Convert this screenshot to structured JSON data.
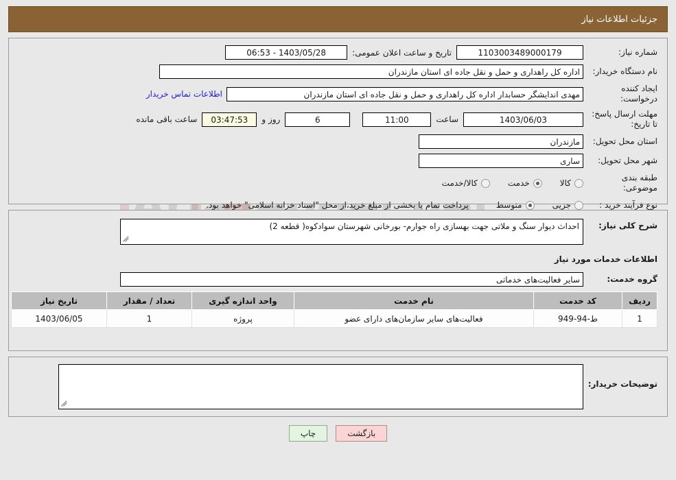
{
  "header": {
    "title": "جزئیات اطلاعات نیاز"
  },
  "form": {
    "need_number_label": "شماره نیاز:",
    "need_number_value": "1103003489000179",
    "public_announce_label": "تاریخ و ساعت اعلان عمومی:",
    "public_announce_value": "1403/05/28 - 06:53",
    "buyer_org_label": "نام دستگاه خریدار:",
    "buyer_org_value": "اداره کل راهداری و حمل و نقل جاده ای استان مازندران",
    "creator_label": "ایجاد کننده درخواست:",
    "creator_value": "مهدی اندایشگر حسابدار اداره کل راهداری و حمل و نقل جاده ای استان مازندران",
    "contact_link": "اطلاعات تماس خریدار",
    "deadline_label": "مهلت ارسال پاسخ: تا تاریخ:",
    "deadline_date": "1403/06/03",
    "hour_label": "ساعت",
    "deadline_time": "11:00",
    "remaining_days": "6",
    "days_and_label": "روز و",
    "remaining_clock": "03:47:53",
    "remaining_suffix": "ساعت باقی مانده",
    "province_label": "استان محل تحویل:",
    "province_value": "مازندران",
    "city_label": "شهر محل تحویل:",
    "city_value": "ساری",
    "category_label": "طبقه بندی موضوعی:",
    "category_options": [
      {
        "label": "کالا",
        "selected": false
      },
      {
        "label": "خدمت",
        "selected": true
      },
      {
        "label": "کالا/خدمت",
        "selected": false
      }
    ],
    "process_label": "نوع فرآیند خرید :",
    "process_options": [
      {
        "label": "جزیی",
        "selected": false
      },
      {
        "label": "متوسط",
        "selected": true
      }
    ],
    "payment_note": "پرداخت تمام یا بخشی از مبلغ خرید،از محل \"اسناد خزانه اسلامی\" خواهد بود."
  },
  "description": {
    "label": "شرح کلی نیاز:",
    "value": "احداث دیوار سنگ و ملاتی جهت بهسازی راه جوارم- بورخانی شهرستان سوادکوه( قطعه 2)"
  },
  "services": {
    "section_title": "اطلاعات خدمات مورد نیاز",
    "group_label": "گروه خدمت:",
    "group_value": "سایر فعالیت‌های خدماتی",
    "columns": [
      "ردیف",
      "کد خدمت",
      "نام خدمت",
      "واحد اندازه گیری",
      "تعداد / مقدار",
      "تاریخ نیاز"
    ],
    "rows": [
      {
        "radif": "1",
        "code": "ط-94-949",
        "name": "فعالیت‌های سایر سازمان‌های دارای عضو",
        "unit": "پروژه",
        "qty": "1",
        "date": "1403/06/05"
      }
    ]
  },
  "buyer_notes": {
    "label": "توضیحات خریدار:",
    "value": ""
  },
  "actions": {
    "back_label": "بازگشت",
    "print_label": "چاپ"
  },
  "colors": {
    "header_bar": "#8a6334",
    "link": "#2222cc",
    "back_button": "#fbd5d5",
    "print_button": "#e3f5e0",
    "countdown_field": "#fbfbe2",
    "table_header": "#bdbdbd"
  }
}
